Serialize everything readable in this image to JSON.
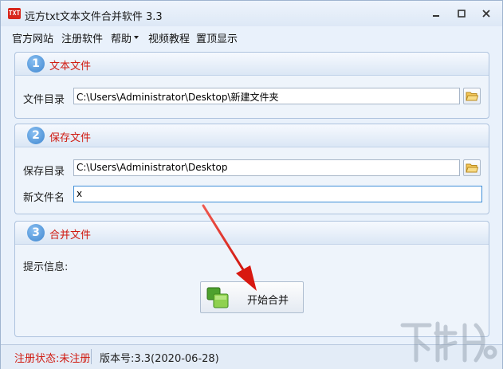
{
  "window": {
    "title": "远方txt文本文件合并软件 3.3",
    "icon_text": "TXT"
  },
  "menu": {
    "official_site": "官方网站",
    "register": "注册软件",
    "help": "帮助",
    "video": "视频教程",
    "pin_top": "置顶显示"
  },
  "section1": {
    "number": "1",
    "title": "文本文件",
    "dir_label": "文件目录",
    "dir_value": "C:\\Users\\Administrator\\Desktop\\新建文件夹"
  },
  "section2": {
    "number": "2",
    "title": "保存文件",
    "dir_label": "保存目录",
    "dir_value": "C:\\Users\\Administrator\\Desktop",
    "name_label": "新文件名",
    "name_value": "x"
  },
  "section3": {
    "number": "3",
    "title": "合并文件",
    "info_label": "提示信息:",
    "merge_button": "开始合并"
  },
  "status": {
    "registration": "注册状态:未注册",
    "version": "版本号:3.3(2020-06-28)"
  },
  "colors": {
    "accent_red": "#d01a10",
    "panel_bg": "#eef4fb",
    "window_bg": "#e9f1fb",
    "arrow": "#e0201a"
  },
  "icons": [
    "app-icon",
    "minimize-icon",
    "maximize-icon",
    "close-icon",
    "chevron-down-icon",
    "folder-icon",
    "merge-icon"
  ]
}
